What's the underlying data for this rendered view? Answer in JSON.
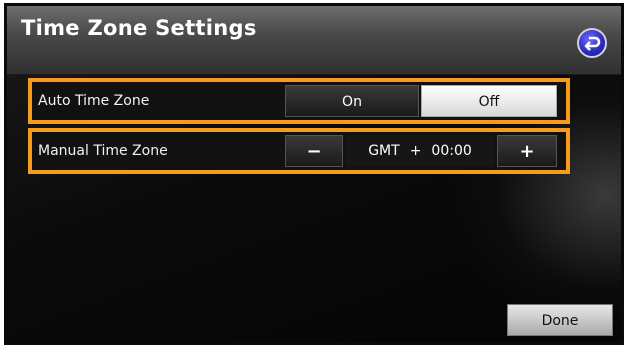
{
  "header": {
    "title": "Time Zone Settings",
    "back_icon": "back-arrow-icon"
  },
  "auto_time_zone": {
    "label": "Auto Time Zone",
    "on_label": "On",
    "off_label": "Off",
    "selected": "Off"
  },
  "manual_time_zone": {
    "label": "Manual Time Zone",
    "minus_label": "−",
    "gmt_label": "GMT",
    "sign": "+",
    "offset": "00:00",
    "plus_label": "+"
  },
  "footer": {
    "done_label": "Done"
  },
  "colors": {
    "highlight": "#f79b1e",
    "back_button": "#2a2ab8"
  }
}
